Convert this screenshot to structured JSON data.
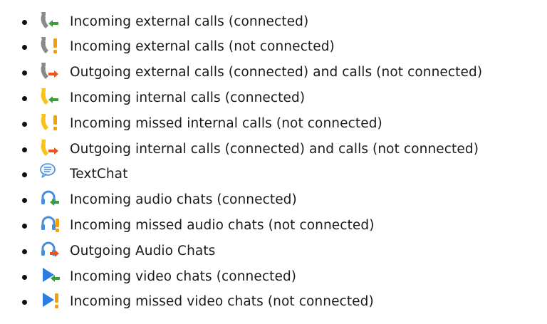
{
  "colors": {
    "handset_external": "#8a8a8a",
    "handset_internal": "#f7c21a",
    "arrow_incoming": "#3aa13a",
    "arrow_outgoing": "#e8561d",
    "alert_missed": "#f2a007",
    "chat_blue": "#4a8ed8",
    "video_blue": "#2d7de0"
  },
  "items": [
    {
      "icon": "incoming-external-call-icon",
      "label": "Incoming external calls (connected)"
    },
    {
      "icon": "missed-external-call-icon",
      "label": "Incoming external calls (not connected)"
    },
    {
      "icon": "outgoing-external-call-icon",
      "label": "Outgoing external calls (connected) and calls (not connected)"
    },
    {
      "icon": "incoming-internal-call-icon",
      "label": "Incoming internal calls (connected)"
    },
    {
      "icon": "missed-internal-call-icon",
      "label": "Incoming missed internal calls (not connected)"
    },
    {
      "icon": "outgoing-internal-call-icon",
      "label": "Outgoing internal calls (connected) and calls (not connected)"
    },
    {
      "icon": "text-chat-icon",
      "label": "TextChat"
    },
    {
      "icon": "incoming-audio-chat-icon",
      "label": "Incoming audio chats (connected)"
    },
    {
      "icon": "missed-audio-chat-icon",
      "label": "Incoming missed audio chats (not connected)"
    },
    {
      "icon": "outgoing-audio-chat-icon",
      "label": "Outgoing Audio Chats"
    },
    {
      "icon": "incoming-video-chat-icon",
      "label": "Incoming video chats (connected)"
    },
    {
      "icon": "missed-video-chat-icon",
      "label": "Incoming missed video chats (not connected)"
    }
  ]
}
